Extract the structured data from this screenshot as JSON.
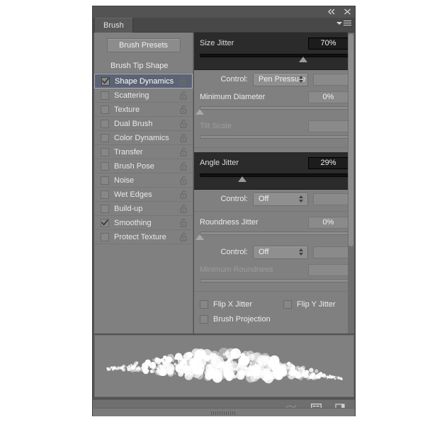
{
  "panel": {
    "tab_label": "Brush",
    "collapse_icon": "double-left-arrow-icon",
    "close_icon": "close-icon",
    "menu_icon": "panel-menu-icon",
    "presets_button": "Brush Presets",
    "tip_shape_label": "Brush Tip Shape"
  },
  "options": [
    {
      "label": "Shape Dynamics",
      "checked": true,
      "selected": true
    },
    {
      "label": "Scattering",
      "checked": false,
      "selected": false
    },
    {
      "label": "Texture",
      "checked": false,
      "selected": false
    },
    {
      "label": "Dual Brush",
      "checked": false,
      "selected": false
    },
    {
      "label": "Color Dynamics",
      "checked": false,
      "selected": false
    },
    {
      "label": "Transfer",
      "checked": false,
      "selected": false
    },
    {
      "label": "Brush Pose",
      "checked": false,
      "selected": false
    },
    {
      "label": "Noise",
      "checked": false,
      "selected": false
    },
    {
      "label": "Wet Edges",
      "checked": false,
      "selected": false
    },
    {
      "label": "Build-up",
      "checked": false,
      "selected": false
    },
    {
      "label": "Smoothing",
      "checked": true,
      "selected": false
    },
    {
      "label": "Protect Texture",
      "checked": false,
      "selected": false
    }
  ],
  "controls": {
    "size_jitter": {
      "label": "Size Jitter",
      "value": "70%",
      "percent": 70,
      "highlighted": true
    },
    "size_control": {
      "label": "Control:",
      "value": "Pen Pressure"
    },
    "minimum_diameter": {
      "label": "Minimum Diameter",
      "value": "0%",
      "percent": 0
    },
    "tilt_scale": {
      "label": "Tilt Scale",
      "value": "",
      "percent": 0,
      "disabled": true
    },
    "angle_jitter": {
      "label": "Angle Jitter",
      "value": "29%",
      "percent": 29,
      "highlighted": true
    },
    "angle_control": {
      "label": "Control:",
      "value": "Off"
    },
    "roundness_jitter": {
      "label": "Roundness Jitter",
      "value": "0%",
      "percent": 0
    },
    "roundness_control": {
      "label": "Control:",
      "value": "Off"
    },
    "minimum_roundness": {
      "label": "Minimum Roundness",
      "value": "",
      "percent": 0,
      "disabled": true
    },
    "flip_x_jitter": {
      "label": "Flip X Jitter",
      "checked": false
    },
    "flip_y_jitter": {
      "label": "Flip Y Jitter",
      "checked": false
    },
    "brush_projection": {
      "label": "Brush Projection",
      "checked": false
    }
  },
  "toolbar": {
    "toggle_brush_icon": "brush-toggle-icon",
    "new_preset_icon": "new-brush-preset-icon",
    "new_brush_icon": "create-new-brush-icon"
  },
  "colors": {
    "panel_bg": "#535353",
    "content_bg": "#808080",
    "highlight_dark": "#2b2b2b",
    "selection_blue": "#5c6374",
    "text": "#ececec"
  }
}
